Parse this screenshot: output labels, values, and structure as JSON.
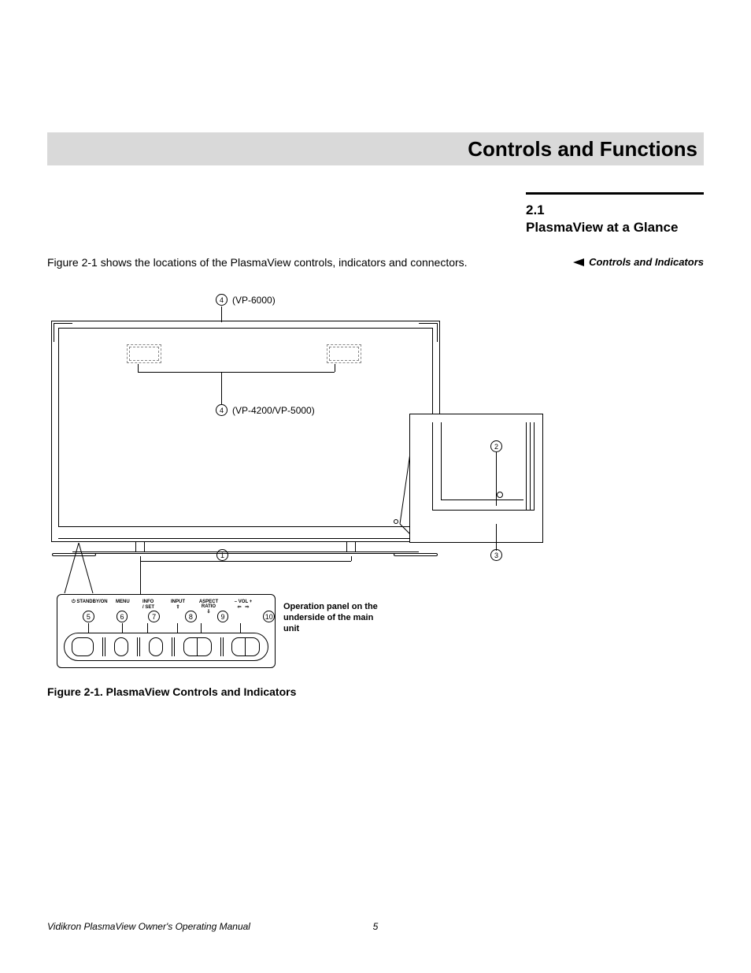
{
  "header": {
    "title": "Controls and Functions"
  },
  "section": {
    "number": "2.1",
    "name": "PlasmaView at a Glance"
  },
  "margin_note": "Controls and Indicators",
  "intro": "Figure 2-1 shows the locations of the PlasmaView controls, indicators and connectors.",
  "callouts": {
    "c4a_num": "4",
    "c4a_text": "(VP-6000)",
    "c4b_num": "4",
    "c4b_text": "(VP-4200/VP-5000)",
    "c1_num": "1",
    "c2_num": "2",
    "c3_num": "3"
  },
  "panel": {
    "labels": {
      "standby": "STANDBY/ON",
      "power_glyph": "⏻",
      "menu": "MENU",
      "info": "INFO\n/ SET",
      "input": "INPUT",
      "input_glyph": "⇧",
      "aspect": "ASPECT RATIO",
      "aspect_glyph": "⇩",
      "vol": "– VOL +",
      "vol_left": "⇦",
      "vol_right": "⇨"
    },
    "callnums": {
      "c5": "5",
      "c6": "6",
      "c7": "7",
      "c8": "8",
      "c9": "9",
      "c10": "10"
    },
    "caption": "Operation panel on the underside of the main unit"
  },
  "figure_caption": "Figure 2-1. PlasmaView Controls and Indicators",
  "footer": {
    "title": "Vidikron PlasmaView Owner's Operating Manual",
    "page": "5"
  }
}
